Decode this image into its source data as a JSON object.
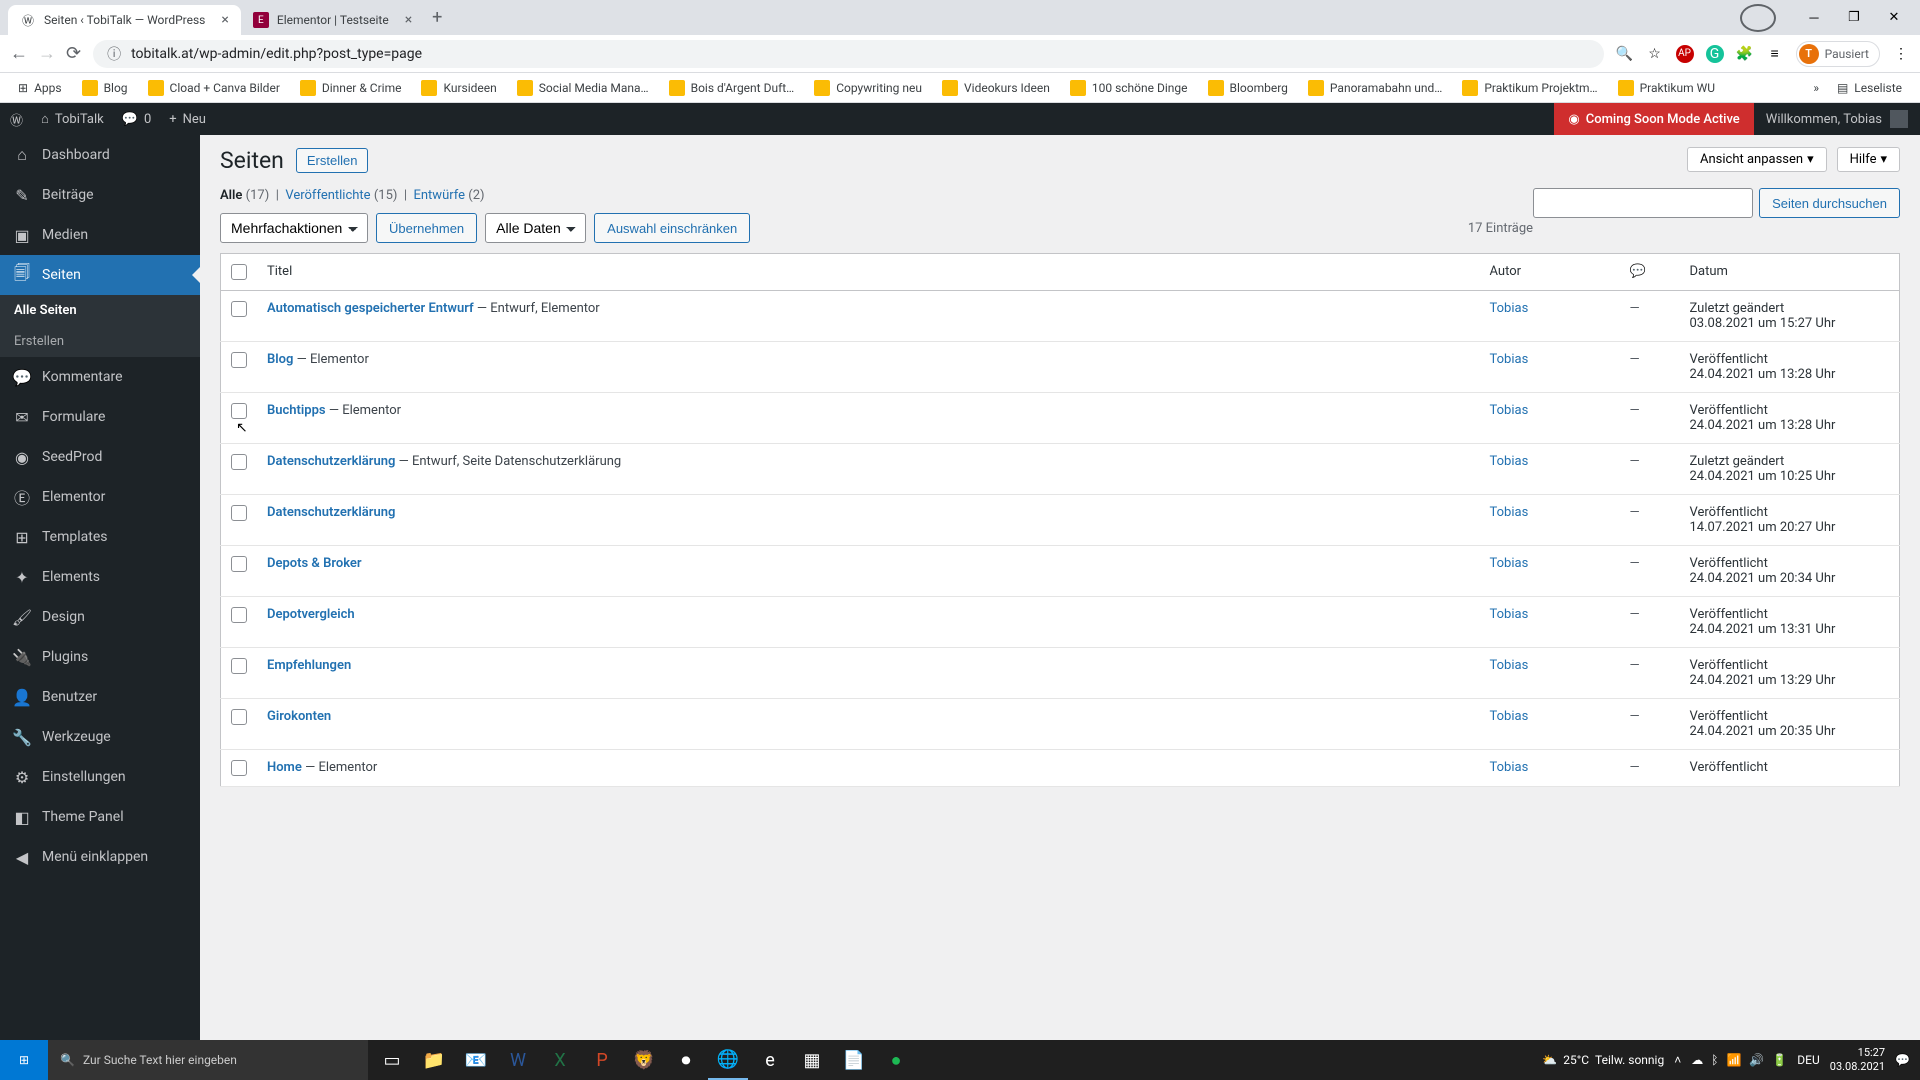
{
  "browser": {
    "tabs": [
      {
        "title": "Seiten ‹ TobiTalk — WordPress",
        "favicon": "wp"
      },
      {
        "title": "Elementor | Testseite",
        "favicon": "e"
      }
    ],
    "url_lock": "⚠",
    "url": "tobitalk.at/wp-admin/edit.php?post_type=page",
    "profile_state": "Pausiert",
    "profile_letter": "T"
  },
  "bookmarks": {
    "apps_label": "Apps",
    "items": [
      "Blog",
      "Cload + Canva Bilder",
      "Dinner & Crime",
      "Kursideen",
      "Social Media Mana…",
      "Bois d'Argent Duft…",
      "Copywriting neu",
      "Videokurs Ideen",
      "100 schöne Dinge",
      "Bloomberg",
      "Panoramabahn und…",
      "Praktikum Projektm…",
      "Praktikum WU"
    ],
    "readlist": "Leseliste"
  },
  "adminbar": {
    "site_name": "TobiTalk",
    "comments_count": "0",
    "new_label": "Neu",
    "soon": "Coming Soon Mode Active",
    "welcome": "Willkommen, Tobias"
  },
  "sidebar": {
    "items": [
      {
        "icon": "⌂",
        "label": "Dashboard"
      },
      {
        "icon": "✎",
        "label": "Beiträge"
      },
      {
        "icon": "▣",
        "label": "Medien"
      },
      {
        "icon": "🗐",
        "label": "Seiten"
      },
      {
        "icon": "💬",
        "label": "Kommentare"
      },
      {
        "icon": "✉",
        "label": "Formulare"
      },
      {
        "icon": "◉",
        "label": "SeedProd"
      },
      {
        "icon": "Ⓔ",
        "label": "Elementor"
      },
      {
        "icon": "⊞",
        "label": "Templates"
      },
      {
        "icon": "✦",
        "label": "Elements"
      },
      {
        "icon": "🖌",
        "label": "Design"
      },
      {
        "icon": "🔌",
        "label": "Plugins"
      },
      {
        "icon": "👤",
        "label": "Benutzer"
      },
      {
        "icon": "🔧",
        "label": "Werkzeuge"
      },
      {
        "icon": "⚙",
        "label": "Einstellungen"
      },
      {
        "icon": "◧",
        "label": "Theme Panel"
      },
      {
        "icon": "◀",
        "label": "Menü einklappen"
      }
    ],
    "submenu": [
      "Alle Seiten",
      "Erstellen"
    ]
  },
  "content": {
    "screen_options": "Ansicht anpassen",
    "help": "Hilfe",
    "heading": "Seiten",
    "add_new": "Erstellen",
    "filters": {
      "all_label": "Alle",
      "all_count": "(17)",
      "published_label": "Veröffentlichte",
      "published_count": "(15)",
      "drafts_label": "Entwürfe",
      "drafts_count": "(2)"
    },
    "search_btn": "Seiten durchsuchen",
    "bulk_action": "Mehrfachaktionen",
    "apply": "Übernehmen",
    "date_filter": "Alle Daten",
    "filter_btn": "Auswahl einschränken",
    "count_text": "17 Einträge",
    "columns": {
      "title": "Titel",
      "author": "Autor",
      "date": "Datum"
    },
    "rows": [
      {
        "title": "Automatisch gespeicherter Entwurf",
        "suffix": " — Entwurf, Elementor",
        "author": "Tobias",
        "status": "Zuletzt geändert",
        "date": "03.08.2021 um 15:27 Uhr"
      },
      {
        "title": "Blog",
        "suffix": " — Elementor",
        "author": "Tobias",
        "status": "Veröffentlicht",
        "date": "24.04.2021 um 13:28 Uhr"
      },
      {
        "title": "Buchtipps",
        "suffix": " — Elementor",
        "author": "Tobias",
        "status": "Veröffentlicht",
        "date": "24.04.2021 um 13:28 Uhr"
      },
      {
        "title": "Datenschutzerklärung",
        "suffix": " — Entwurf, Seite Datenschutzerklärung",
        "author": "Tobias",
        "status": "Zuletzt geändert",
        "date": "24.04.2021 um 10:25 Uhr"
      },
      {
        "title": "Datenschutzerklärung",
        "suffix": "",
        "author": "Tobias",
        "status": "Veröffentlicht",
        "date": "14.07.2021 um 20:27 Uhr"
      },
      {
        "title": "Depots & Broker",
        "suffix": "",
        "author": "Tobias",
        "status": "Veröffentlicht",
        "date": "24.04.2021 um 20:34 Uhr"
      },
      {
        "title": "Depotvergleich",
        "suffix": "",
        "author": "Tobias",
        "status": "Veröffentlicht",
        "date": "24.04.2021 um 13:31 Uhr"
      },
      {
        "title": "Empfehlungen",
        "suffix": "",
        "author": "Tobias",
        "status": "Veröffentlicht",
        "date": "24.04.2021 um 13:29 Uhr"
      },
      {
        "title": "Girokonten",
        "suffix": "",
        "author": "Tobias",
        "status": "Veröffentlicht",
        "date": "24.04.2021 um 20:35 Uhr"
      },
      {
        "title": "Home",
        "suffix": " — Elementor",
        "author": "Tobias",
        "status": "Veröffentlicht",
        "date": ""
      }
    ]
  },
  "taskbar": {
    "search_placeholder": "Zur Suche Text hier eingeben",
    "weather_temp": "25°C",
    "weather_text": "Teilw. sonnig",
    "lang": "DEU",
    "time": "15:27",
    "date": "03.08.2021"
  }
}
